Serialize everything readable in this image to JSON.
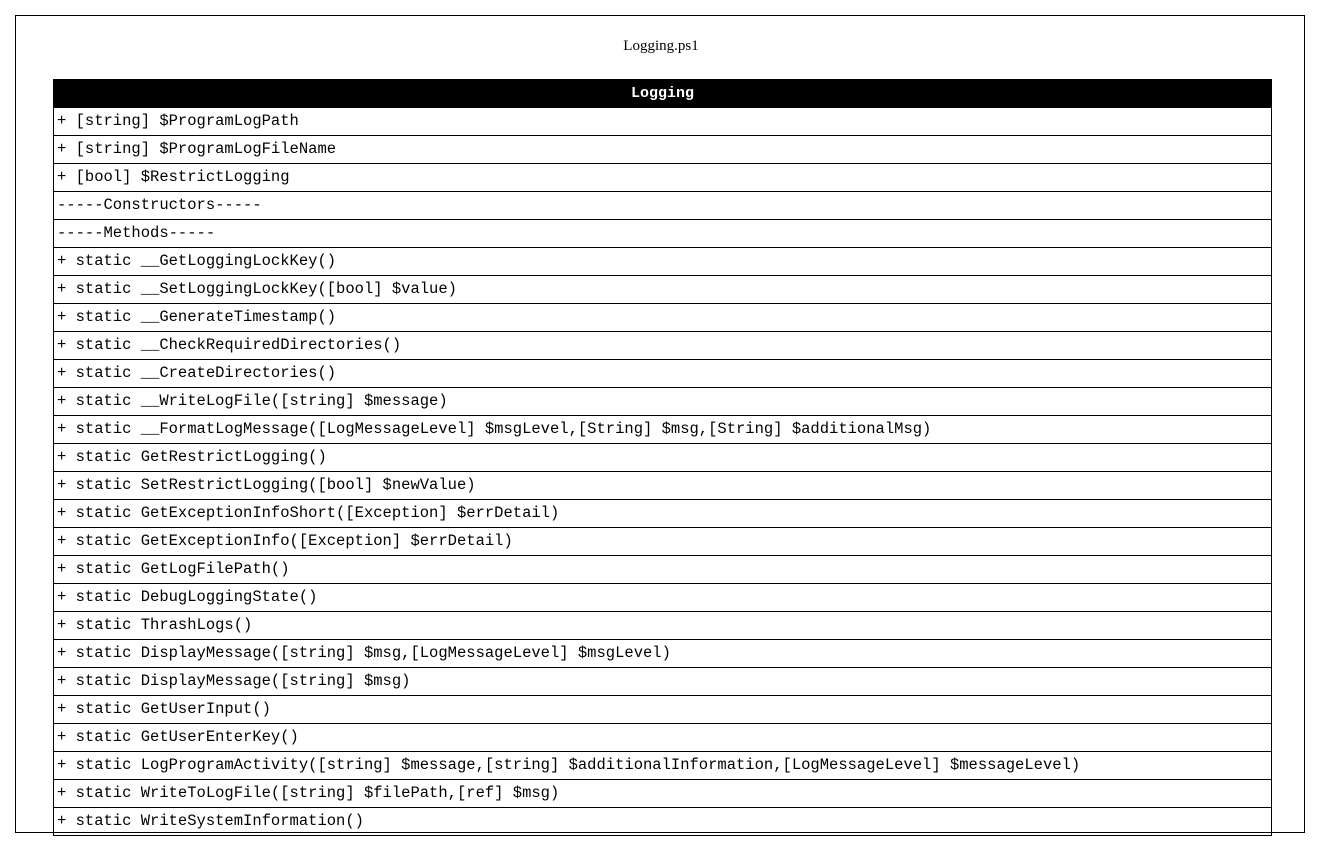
{
  "diagram": {
    "title": "Logging.ps1",
    "class": {
      "name": "Logging",
      "rows": [
        "+ [string] $ProgramLogPath",
        "+ [string] $ProgramLogFileName",
        "+ [bool] $RestrictLogging",
        "-----Constructors-----",
        "-----Methods-----",
        "+ static __GetLoggingLockKey()",
        "+ static __SetLoggingLockKey([bool] $value)",
        "+ static __GenerateTimestamp()",
        "+ static __CheckRequiredDirectories()",
        "+ static __CreateDirectories()",
        "+ static __WriteLogFile([string] $message)",
        "+ static __FormatLogMessage([LogMessageLevel] $msgLevel,[String] $msg,[String] $additionalMsg)",
        "+ static GetRestrictLogging()",
        "+ static SetRestrictLogging([bool] $newValue)",
        "+ static GetExceptionInfoShort([Exception] $errDetail)",
        "+ static GetExceptionInfo([Exception] $errDetail)",
        "+ static GetLogFilePath()",
        "+ static DebugLoggingState()",
        "+ static ThrashLogs()",
        "+ static DisplayMessage([string] $msg,[LogMessageLevel] $msgLevel)",
        "+ static DisplayMessage([string] $msg)",
        "+ static GetUserInput()",
        "+ static GetUserEnterKey()",
        "+ static LogProgramActivity([string] $message,[string] $additionalInformation,[LogMessageLevel] $messageLevel)",
        "+ static WriteToLogFile([string] $filePath,[ref] $msg)",
        "+ static WriteSystemInformation()"
      ]
    }
  }
}
